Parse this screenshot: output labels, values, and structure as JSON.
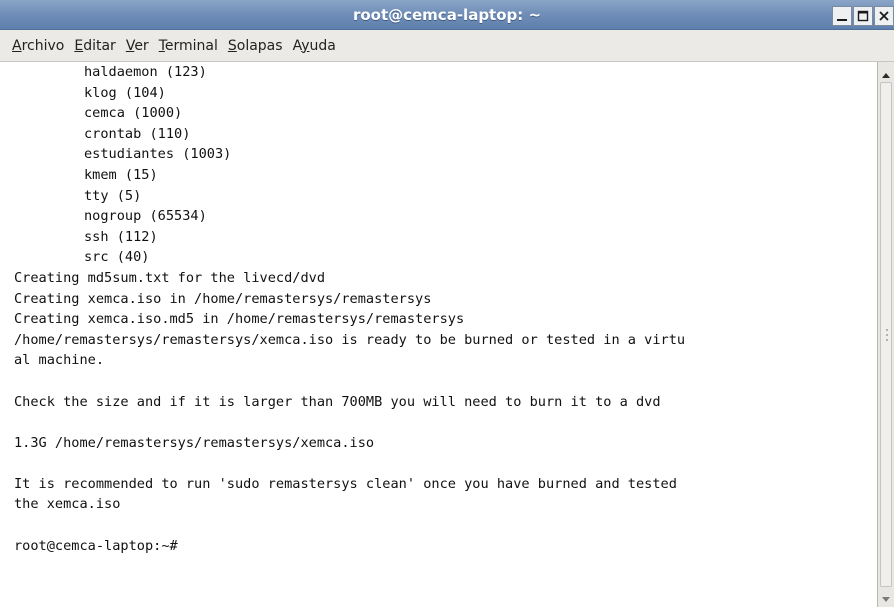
{
  "window": {
    "title": "root@cemca-laptop: ~"
  },
  "menubar": {
    "items": [
      {
        "mnemonic": "A",
        "rest": "rchivo"
      },
      {
        "mnemonic": "E",
        "rest": "ditar"
      },
      {
        "mnemonic": "V",
        "rest": "er"
      },
      {
        "mnemonic": "T",
        "rest": "erminal"
      },
      {
        "mnemonic": "S",
        "rest": "olapas"
      },
      {
        "pre": "A",
        "mnemonic": "y",
        "rest": "uda"
      }
    ]
  },
  "terminal": {
    "lines": [
      {
        "text": "haldaemon (123)",
        "indent": true
      },
      {
        "text": "klog (104)",
        "indent": true
      },
      {
        "text": "cemca (1000)",
        "indent": true
      },
      {
        "text": "crontab (110)",
        "indent": true
      },
      {
        "text": "estudiantes (1003)",
        "indent": true
      },
      {
        "text": "kmem (15)",
        "indent": true
      },
      {
        "text": "tty (5)",
        "indent": true
      },
      {
        "text": "nogroup (65534)",
        "indent": true
      },
      {
        "text": "ssh (112)",
        "indent": true
      },
      {
        "text": "src (40)",
        "indent": true
      },
      {
        "text": "Creating md5sum.txt for the livecd/dvd",
        "indent": false
      },
      {
        "text": "Creating xemca.iso in /home/remastersys/remastersys",
        "indent": false
      },
      {
        "text": "Creating xemca.iso.md5 in /home/remastersys/remastersys",
        "indent": false
      },
      {
        "text": "/home/remastersys/remastersys/xemca.iso is ready to be burned or tested in a virtu",
        "indent": false
      },
      {
        "text": "al machine.",
        "indent": false
      },
      {
        "text": "",
        "indent": false
      },
      {
        "text": "Check the size and if it is larger than 700MB you will need to burn it to a dvd",
        "indent": false
      },
      {
        "text": "",
        "indent": false
      },
      {
        "text": "1.3G /home/remastersys/remastersys/xemca.iso",
        "indent": false
      },
      {
        "text": "",
        "indent": false
      },
      {
        "text": "It is recommended to run 'sudo remastersys clean' once you have burned and tested",
        "indent": false
      },
      {
        "text": "the xemca.iso",
        "indent": false
      },
      {
        "text": "",
        "indent": false
      },
      {
        "text": "root@cemca-laptop:~#",
        "indent": false
      }
    ]
  },
  "icons": {
    "minimize": "minimize-icon",
    "maximize": "maximize-icon",
    "close": "close-icon",
    "scroll_up": "arrow-up-icon",
    "scroll_down": "arrow-down-icon"
  },
  "colors": {
    "titlebar": "#6e8db7",
    "terminal_bg": "#ffffff",
    "terminal_fg": "#111111",
    "menubar_bg": "#eceae6"
  }
}
